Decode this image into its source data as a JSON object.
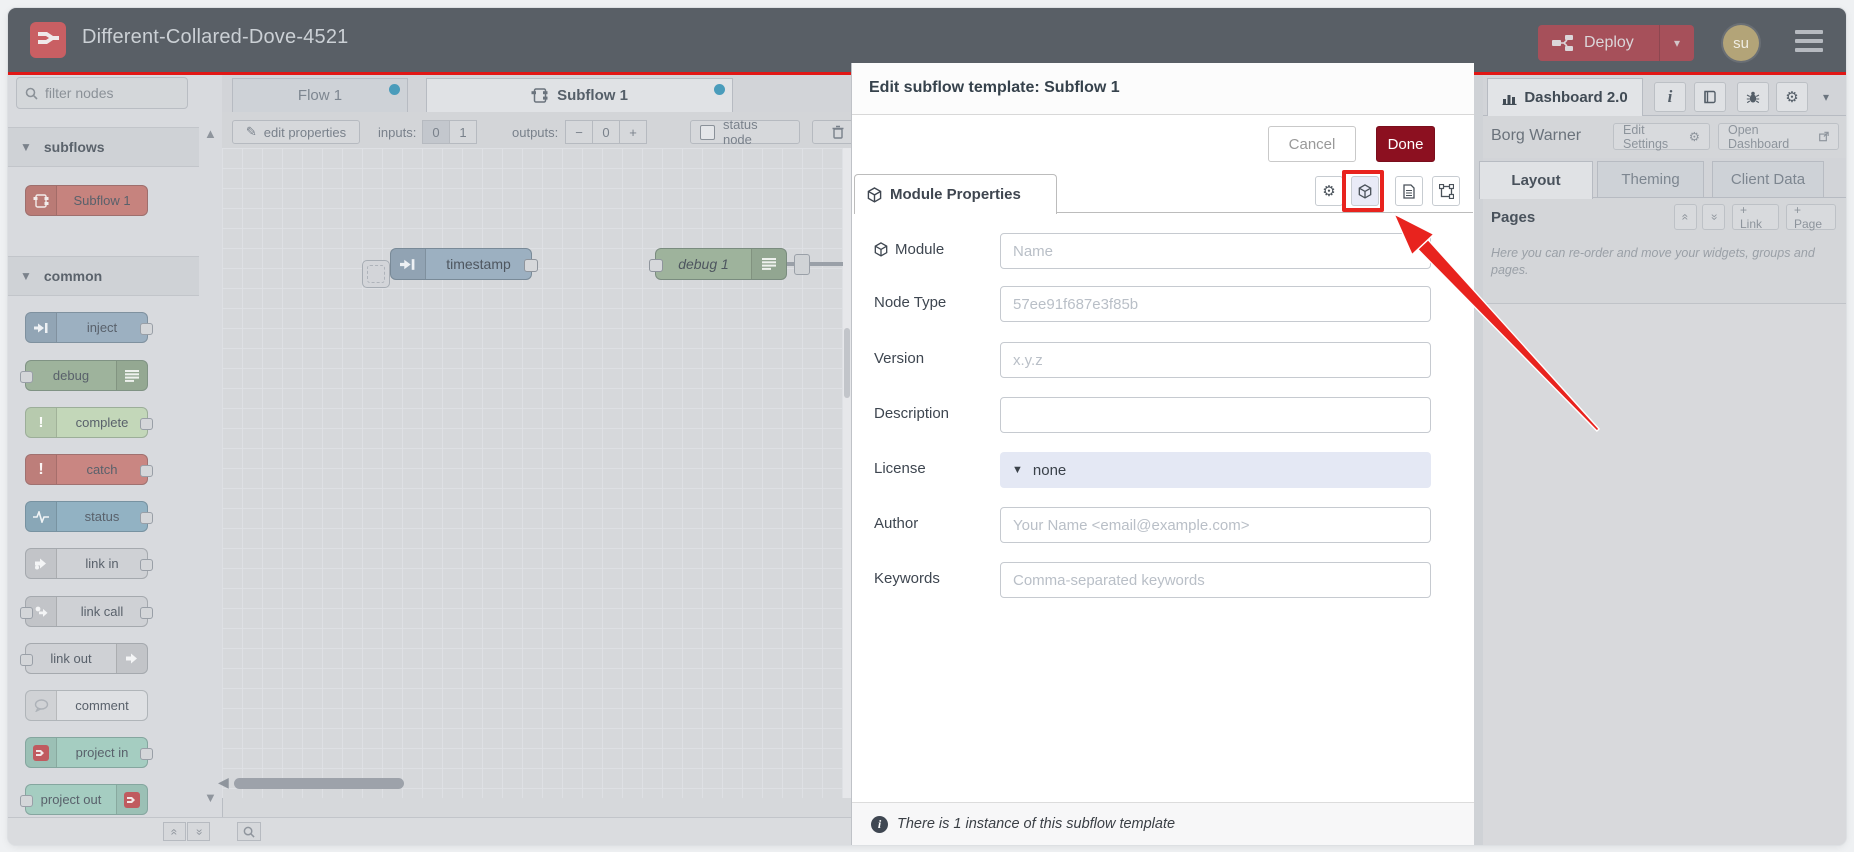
{
  "header": {
    "title": "Different-Collared-Dove-4521",
    "deploy_label": "Deploy",
    "avatar_initials": "su"
  },
  "workspace_tabs": {
    "flow1": "Flow 1",
    "subflow1": "Subflow 1"
  },
  "palette": {
    "filter_placeholder": "filter nodes",
    "categories": [
      {
        "label": "subflows",
        "nodes": [
          {
            "label": "Subflow 1"
          }
        ]
      },
      {
        "label": "common",
        "nodes": [
          {
            "label": "inject"
          },
          {
            "label": "debug"
          },
          {
            "label": "complete"
          },
          {
            "label": "catch"
          },
          {
            "label": "status"
          },
          {
            "label": "link in"
          },
          {
            "label": "link call"
          },
          {
            "label": "link out"
          },
          {
            "label": "comment"
          },
          {
            "label": "project in"
          },
          {
            "label": "project out"
          }
        ]
      }
    ]
  },
  "subflow_toolbar": {
    "edit_properties": "edit properties",
    "inputs_label": "inputs:",
    "input_zero": "0",
    "input_one": "1",
    "outputs_label": "outputs:",
    "output_minus": "−",
    "output_value": "0",
    "output_plus": "+",
    "status_node": "status node"
  },
  "canvas": {
    "inject_node": "timestamp",
    "debug_node": "debug 1"
  },
  "dialog": {
    "title": "Edit subflow template: Subflow 1",
    "cancel": "Cancel",
    "done": "Done",
    "tab": "Module Properties",
    "form": {
      "rows": [
        {
          "label": "Module",
          "placeholder": "Name"
        },
        {
          "label": "Node Type",
          "placeholder": "57ee91f687e3f85b"
        },
        {
          "label": "Version",
          "placeholder": "x.y.z"
        },
        {
          "label": "Description",
          "placeholder": ""
        },
        {
          "label": "License",
          "value": "none"
        },
        {
          "label": "Author",
          "placeholder": "Your Name <email@example.com>"
        },
        {
          "label": "Keywords",
          "placeholder": "Comma-separated keywords"
        }
      ]
    },
    "footer_note": "There is 1 instance of this subflow template"
  },
  "sidebar": {
    "tab": "Dashboard 2.0",
    "project": "Borg Warner",
    "edit_settings": "Edit Settings",
    "open_dashboard": "Open Dashboard",
    "tabs": {
      "layout": "Layout",
      "theming": "Theming",
      "client_data": "Client Data"
    },
    "pages_title": "Pages",
    "link_button": "+ Link",
    "page_button": "+ Page",
    "description": "Here you can re-order and move your widgets, groups and pages."
  },
  "colors": {
    "header_bg": "#595f66",
    "header_red_line": "#e11715",
    "deploy_button": "#a6505a",
    "done_button": "#8C1020",
    "modified_dot": "#4a9cbb",
    "annotation_red": "#e8231e",
    "subflow_node": "#c6837e",
    "inject_node": "#9cb0c1",
    "debug_node": "#9eb39c",
    "complete_node": "#c3d7b9",
    "catch_node": "#c98682",
    "status_node": "#92b2c3",
    "link_node": "#cfd1d5",
    "comment_node": "#dee0e3",
    "project_node": "#a5cdc1",
    "license_select_bg": "#e4e8f4"
  }
}
